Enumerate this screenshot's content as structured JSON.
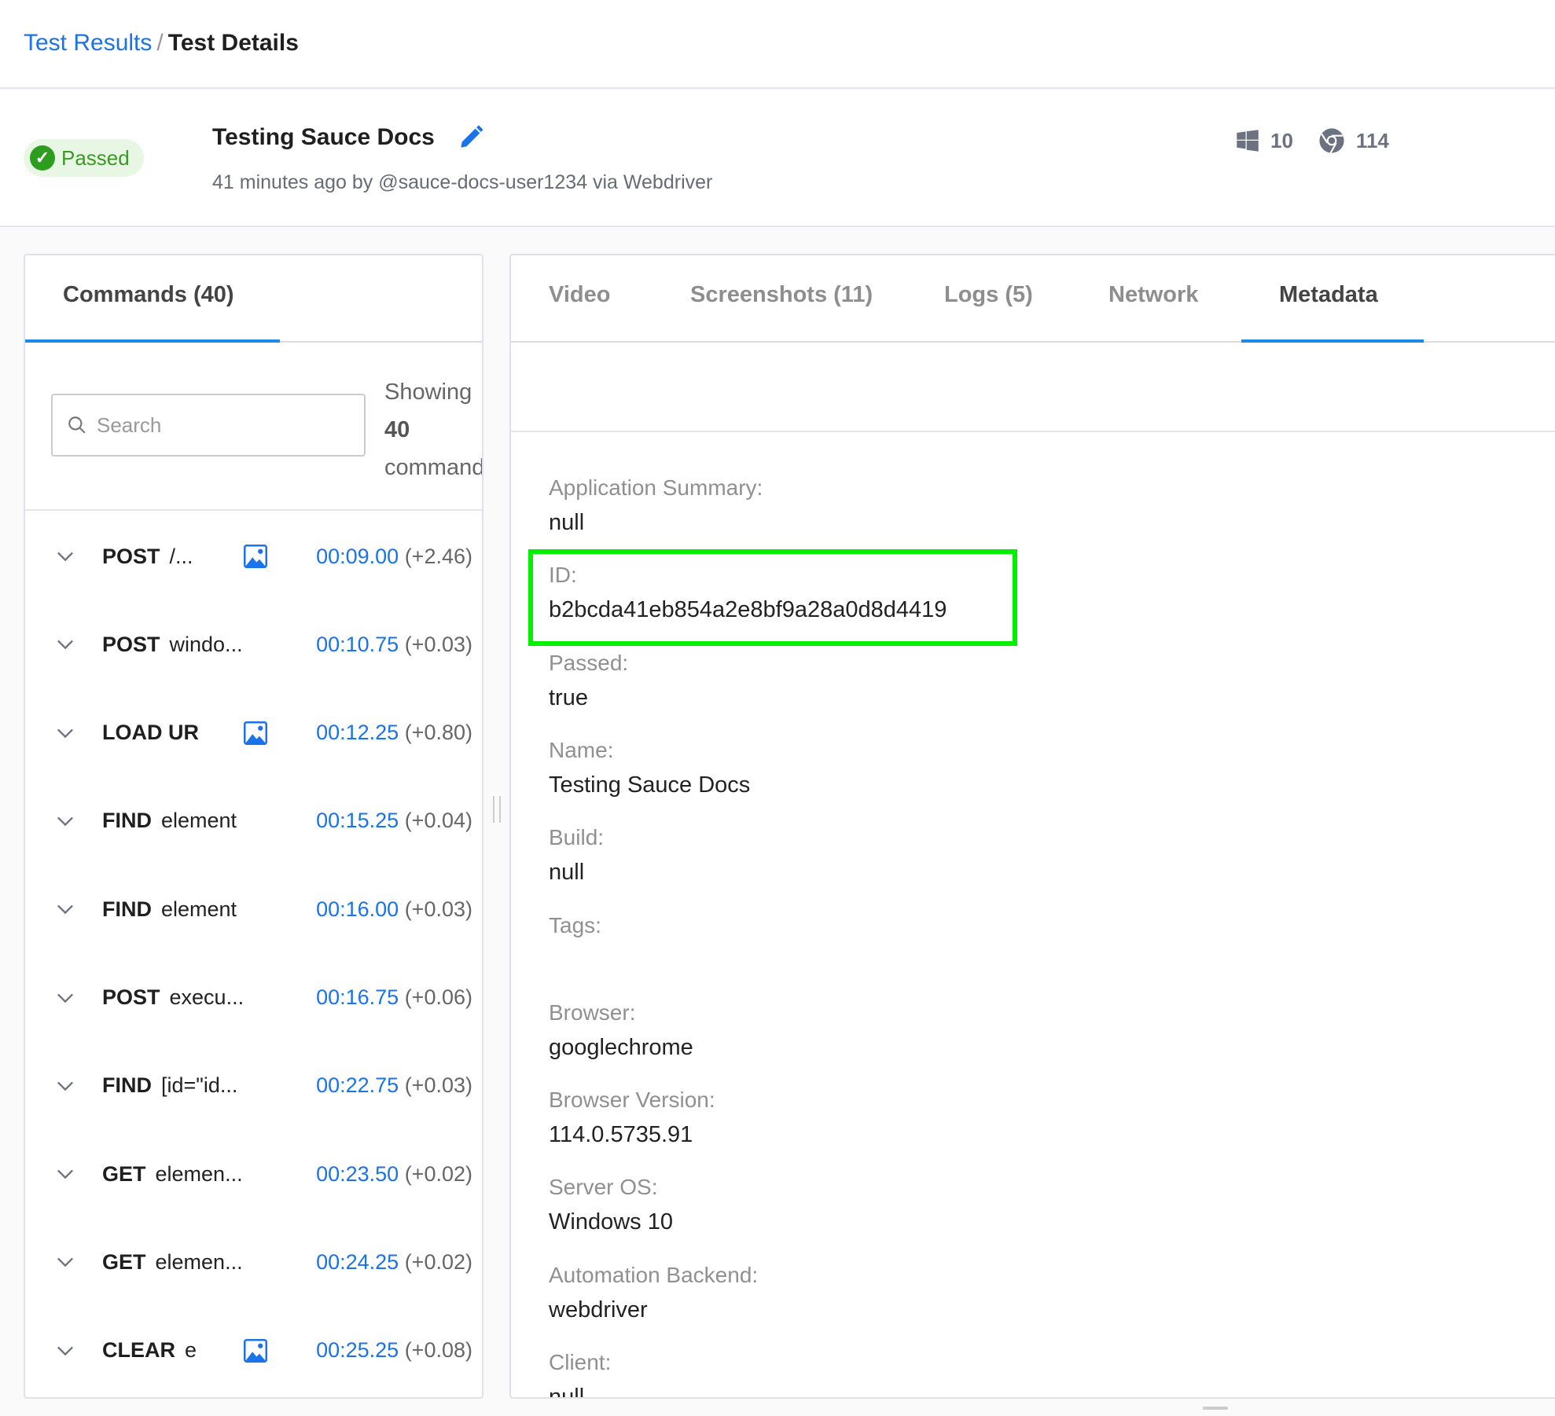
{
  "breadcrumb": {
    "parent": "Test Results",
    "separator": "/",
    "current": "Test Details"
  },
  "header": {
    "status": "Passed",
    "title": "Testing Sauce Docs",
    "subtitle": "41 minutes ago by @sauce-docs-user1234 via Webdriver",
    "os_icon": "windows-icon",
    "os_version": "10",
    "browser_icon": "chrome-icon",
    "browser_version": "114"
  },
  "colors": {
    "accent": "#1a73e8",
    "passed": "#2d9d1f",
    "highlight": "#00f000"
  },
  "commands": {
    "tab_label": "Commands (40)",
    "search_placeholder": "Search",
    "showing_prefix": "Showing",
    "showing_count": "40",
    "showing_suffix": "commands",
    "rows": [
      {
        "method": "POST",
        "arg": "/...",
        "screenshot": true,
        "time": "00:09.00",
        "delta": "(+2.46)"
      },
      {
        "method": "POST",
        "arg": "windo...",
        "screenshot": false,
        "time": "00:10.75",
        "delta": "(+0.03)"
      },
      {
        "method": "LOAD UR",
        "arg": "",
        "screenshot": true,
        "time": "00:12.25",
        "delta": "(+0.80)"
      },
      {
        "method": "FIND",
        "arg": "element",
        "screenshot": false,
        "time": "00:15.25",
        "delta": "(+0.04)"
      },
      {
        "method": "FIND",
        "arg": "element",
        "screenshot": false,
        "time": "00:16.00",
        "delta": "(+0.03)"
      },
      {
        "method": "POST",
        "arg": "execu...",
        "screenshot": false,
        "time": "00:16.75",
        "delta": "(+0.06)"
      },
      {
        "method": "FIND",
        "arg": "[id=\"id...",
        "screenshot": false,
        "time": "00:22.75",
        "delta": "(+0.03)"
      },
      {
        "method": "GET",
        "arg": "elemen...",
        "screenshot": false,
        "time": "00:23.50",
        "delta": "(+0.02)"
      },
      {
        "method": "GET",
        "arg": "elemen...",
        "screenshot": false,
        "time": "00:24.25",
        "delta": "(+0.02)"
      },
      {
        "method": "CLEAR",
        "arg": "e",
        "screenshot": true,
        "time": "00:25.25",
        "delta": "(+0.08)"
      }
    ]
  },
  "tabs": [
    {
      "label": "Video"
    },
    {
      "label": "Screenshots (11)"
    },
    {
      "label": "Logs (5)"
    },
    {
      "label": "Network"
    },
    {
      "label": "Metadata",
      "active": true
    }
  ],
  "metadata": [
    {
      "label": "Application Summary:",
      "value": "null"
    },
    {
      "label": "ID:",
      "value": "b2bcda41eb854a2e8bf9a28a0d8d4419"
    },
    {
      "label": "Passed:",
      "value": "true"
    },
    {
      "label": "Name:",
      "value": "Testing Sauce Docs"
    },
    {
      "label": "Build:",
      "value": "null"
    },
    {
      "label": "Tags:",
      "value": ""
    },
    {
      "label": "Browser:",
      "value": "googlechrome"
    },
    {
      "label": "Browser Version:",
      "value": "114.0.5735.91"
    },
    {
      "label": "Server OS:",
      "value": "Windows 10"
    },
    {
      "label": "Automation Backend:",
      "value": "webdriver"
    },
    {
      "label": "Client:",
      "value": "null"
    }
  ]
}
